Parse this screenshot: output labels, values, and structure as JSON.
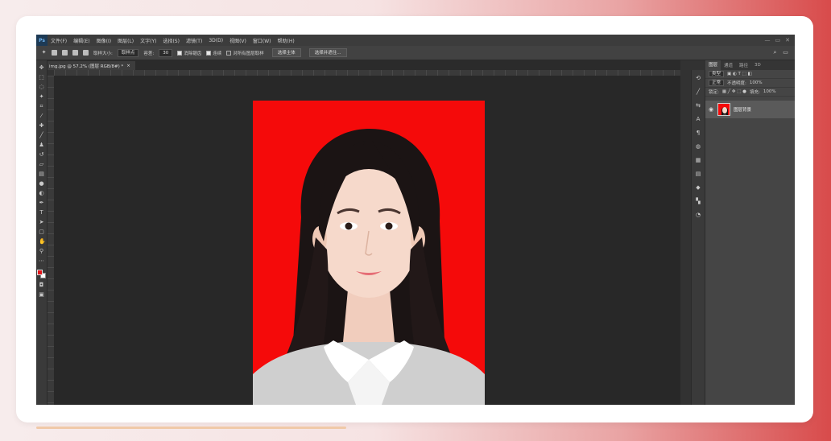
{
  "app": {
    "logo": "Ps"
  },
  "menu": [
    "文件(F)",
    "编辑(E)",
    "图像(I)",
    "图层(L)",
    "文字(Y)",
    "选择(S)",
    "滤镜(T)",
    "3D(D)",
    "视图(V)",
    "窗口(W)",
    "帮助(H)"
  ],
  "window_controls": [
    "—",
    "▭",
    "✕"
  ],
  "options": {
    "size_label": "取样大小:",
    "size_value": "取样点",
    "tolerance_label": "容差:",
    "tolerance_value": "30",
    "antialias_label": "消除锯齿",
    "contiguous_label": "连续",
    "sample_all_label": "对所有图层取样",
    "select_subject_button": "选择主体",
    "select_mask_button": "选择并遮住...",
    "right_icons": [
      "search-icon",
      "workspace-icon"
    ]
  },
  "document_tab": {
    "label": "img.jpg @ 57.2% (图层 RGB/8#) *",
    "close": "×"
  },
  "tools": [
    "move-icon",
    "marquee-icon",
    "lasso-icon",
    "magic-wand-icon",
    "crop-icon",
    "eyedropper-icon",
    "healing-icon",
    "brush-icon",
    "stamp-icon",
    "history-brush-icon",
    "eraser-icon",
    "gradient-icon",
    "blur-icon",
    "dodge-icon",
    "pen-icon",
    "type-icon",
    "path-select-icon",
    "shape-icon",
    "hand-icon",
    "zoom-icon",
    "more-tools-icon"
  ],
  "swatch_colors": {
    "foreground": "#e3161b",
    "background": "#ffffff"
  },
  "canvas": {
    "background_color": "#f50a0a"
  },
  "right_strip_icons": [
    "history-icon",
    "brush-settings-icon",
    "adjust-icon",
    "character-icon",
    "paragraph-icon",
    "color-icon",
    "swatches-icon",
    "libraries-icon",
    "layers-icon",
    "channels-icon",
    "paths-icon"
  ],
  "panel": {
    "tabs": [
      "图层",
      "通道",
      "路径",
      "3D"
    ],
    "active_tab": "图层",
    "kind_label": "类型",
    "blend_mode": "正常",
    "opacity_label": "不透明度:",
    "opacity_value": "100%",
    "lock_label": "锁定:",
    "fill_label": "填充:",
    "fill_value": "100%",
    "layer_name": "图层背景"
  }
}
